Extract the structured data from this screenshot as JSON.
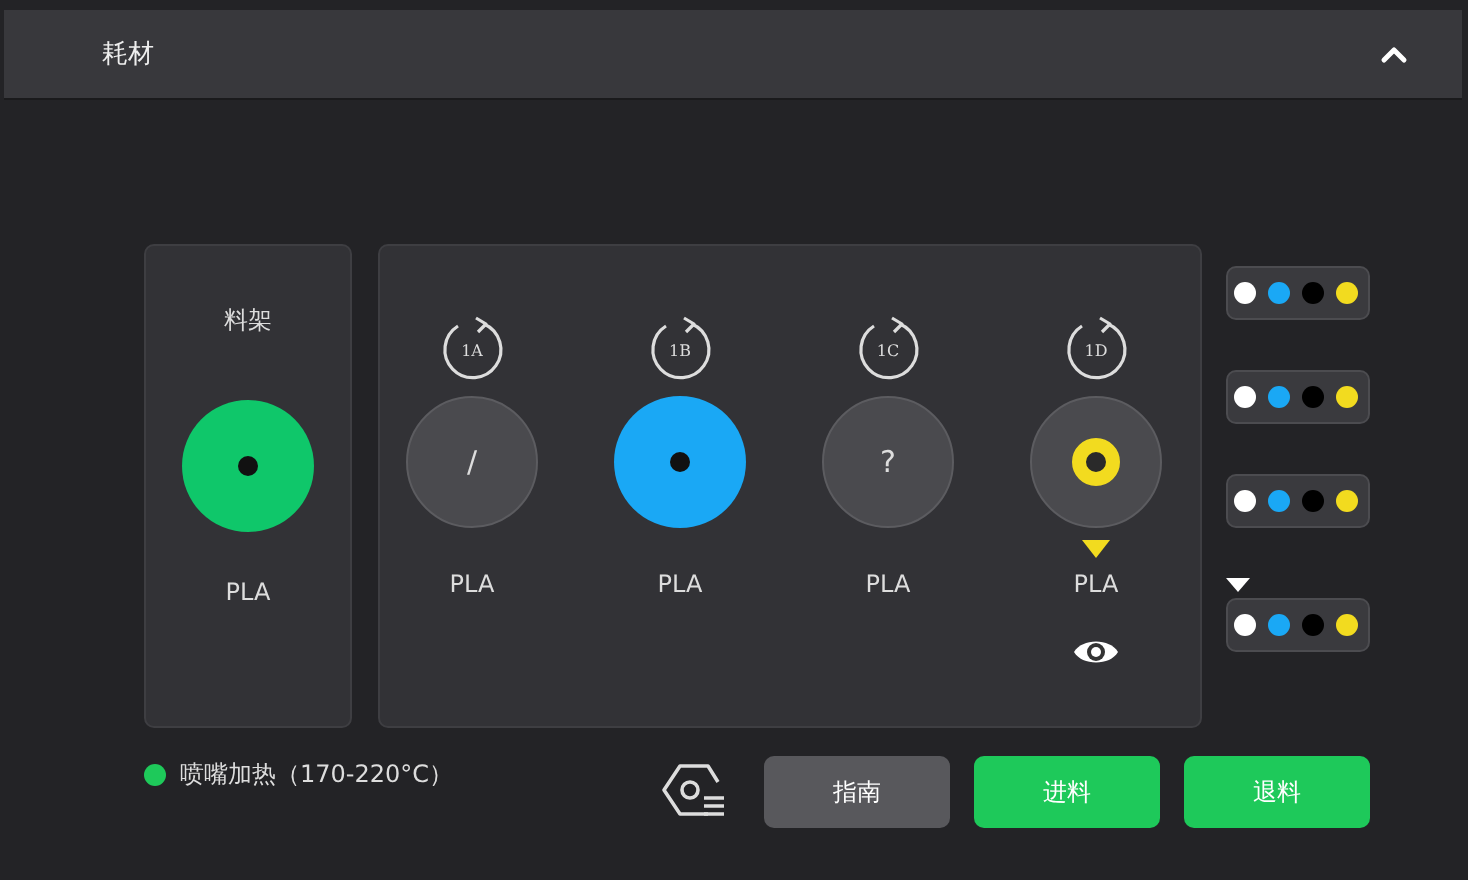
{
  "header": {
    "title": "耗材",
    "expanded": true
  },
  "rack": {
    "title": "料架",
    "color": "#0fc76a",
    "material": "PLA"
  },
  "slots": [
    {
      "id": "1A",
      "kind": "empty",
      "symbol": "/",
      "material": "PLA",
      "active": false,
      "preview": false
    },
    {
      "id": "1B",
      "kind": "filled",
      "color": "#1aa8f5",
      "material": "PLA",
      "active": false,
      "preview": false
    },
    {
      "id": "1C",
      "kind": "unknown",
      "symbol": "?",
      "material": "PLA",
      "active": false,
      "preview": false
    },
    {
      "id": "1D",
      "kind": "ring",
      "color": "#f2db1f",
      "material": "PLA",
      "active": true,
      "preview": true
    }
  ],
  "units": [
    {
      "selected": false,
      "spools": [
        {
          "color": "#ffffff"
        },
        {
          "color": "#1aa8f5"
        },
        {
          "color": "#000000"
        },
        {
          "color": "#f2db1f"
        }
      ]
    },
    {
      "selected": false,
      "spools": [
        {
          "color": "#ffffff"
        },
        {
          "color": "#1aa8f5"
        },
        {
          "color": "#000000"
        },
        {
          "color": "#f2db1f"
        }
      ]
    },
    {
      "selected": false,
      "spools": [
        {
          "color": "#ffffff"
        },
        {
          "color": "#1aa8f5"
        },
        {
          "color": "#000000"
        },
        {
          "color": "#f2db1f"
        }
      ]
    },
    {
      "selected": true,
      "spools": [
        {
          "color": "#ffffff"
        },
        {
          "color": "#1aa8f5"
        },
        {
          "color": "#000000"
        },
        {
          "color": "#f2db1f"
        }
      ]
    }
  ],
  "status": {
    "color": "#1ec95a",
    "text": "喷嘴加热（170-220°C）"
  },
  "buttons": [
    {
      "label": "指南",
      "kind": "secondary"
    },
    {
      "label": "进料",
      "kind": "primary"
    },
    {
      "label": "退料",
      "kind": "primary"
    }
  ]
}
